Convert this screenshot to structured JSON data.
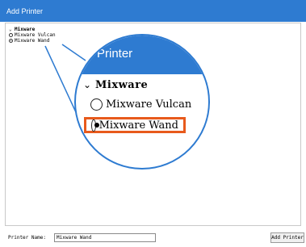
{
  "window": {
    "title": "Add Printer"
  },
  "tree": {
    "group": {
      "label": "Mixware",
      "expanded": true
    },
    "items": [
      {
        "label": "Mixware Vulcan",
        "selected": false
      },
      {
        "label": "Mixware Wand",
        "selected": true
      }
    ]
  },
  "magnifier": {
    "title": "Printer",
    "group_label": "Mixware",
    "items": [
      {
        "label": "Mixware Vulcan"
      },
      {
        "label": "Mixware Wand"
      }
    ],
    "highlight_color": "#e85a1c"
  },
  "footer": {
    "name_label": "Printer Name:",
    "name_value": "Mixware Wand",
    "add_button_label": "Add Printer"
  },
  "colors": {
    "accent": "#2e7bd1"
  }
}
